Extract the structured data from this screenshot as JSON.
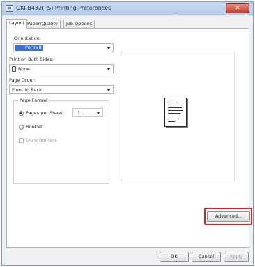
{
  "window": {
    "title": "OKI B432(PS) Printing Preferences",
    "close_glyph": "✕"
  },
  "tabs": [
    {
      "label": "Layout"
    },
    {
      "label": "Paper/Quality"
    },
    {
      "label": "Job Options"
    }
  ],
  "layout": {
    "orientation_label": "Orientation:",
    "orientation_value": "Portrait",
    "duplex_label": "Print on Both Sides:",
    "duplex_value": "None",
    "page_order_label": "Page Order:",
    "page_order_value": "Front to Back",
    "page_format": {
      "title": "Page Format",
      "pages_per_sheet_label": "Pages per Sheet",
      "pages_per_sheet_value": "1",
      "booklet_label": "Booklet",
      "draw_borders_label": "Draw Borders"
    }
  },
  "buttons": {
    "advanced": "Advanced...",
    "ok": "OK",
    "cancel": "Cancel",
    "apply": "Apply"
  },
  "icons": {
    "printer": "printer-icon",
    "duplex": "duplex-none-icon"
  },
  "colors": {
    "highlight": "#d9252a",
    "selection": "#3a6fd8"
  }
}
